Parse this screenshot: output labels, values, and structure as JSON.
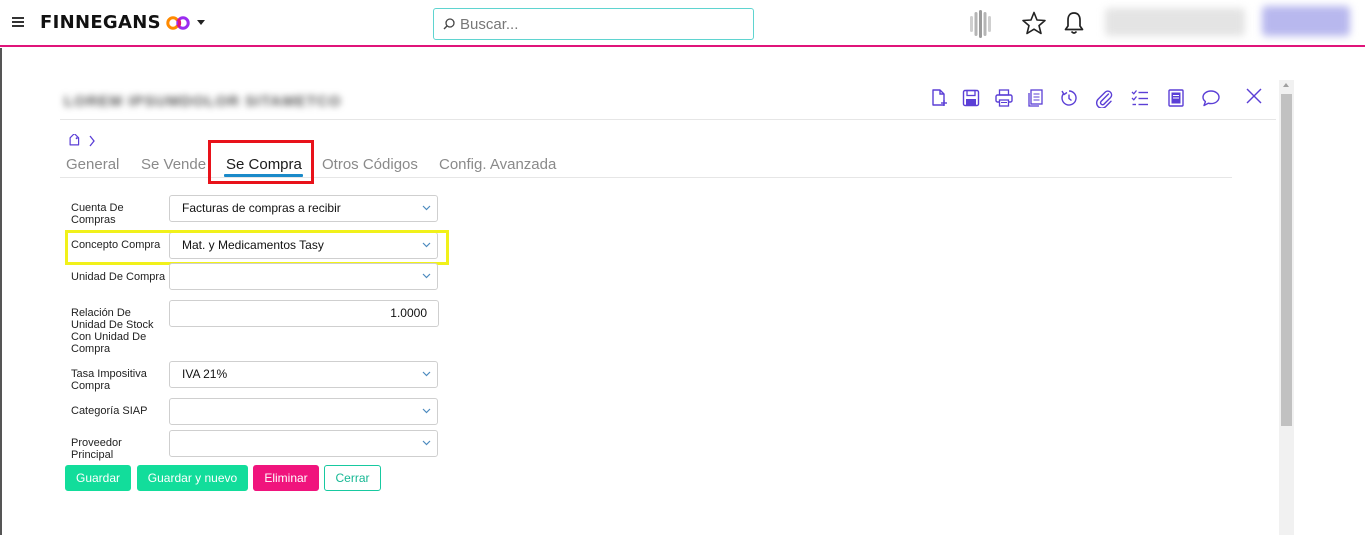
{
  "brand": {
    "name": "FINNEGANS"
  },
  "search": {
    "placeholder": "Buscar..."
  },
  "tabs": [
    {
      "label": "General"
    },
    {
      "label": "Se Vende"
    },
    {
      "label": "Se Compra"
    },
    {
      "label": "Otros Códigos"
    },
    {
      "label": "Config. Avanzada"
    }
  ],
  "form": {
    "cuenta_compras": {
      "label": "Cuenta De Compras",
      "value": "Facturas de compras a recibir"
    },
    "concepto_compra": {
      "label": "Concepto Compra",
      "value": "Mat. y Medicamentos Tasy"
    },
    "unidad_compra": {
      "label": "Unidad De Compra",
      "value": ""
    },
    "relacion_unidad": {
      "label": "Relación De Unidad De Stock Con Unidad De Compra",
      "value": "1.0000"
    },
    "tasa_impositiva": {
      "label": "Tasa Impositiva Compra",
      "value": "IVA 21%"
    },
    "categoria_siap": {
      "label": "Categoría SIAP",
      "value": ""
    },
    "proveedor_principal": {
      "label": "Proveedor Principal",
      "value": ""
    }
  },
  "buttons": {
    "guardar": "Guardar",
    "guardar_nuevo": "Guardar y nuevo",
    "eliminar": "Eliminar",
    "cerrar": "Cerrar"
  },
  "colors": {
    "accent_pink": "#e0147a",
    "search_border": "#5fd4d0",
    "tab_underline": "#1a8ac9",
    "toolbar_icon": "#5b3fd6",
    "button_green": "#12dd9b",
    "button_pink": "#f0147d",
    "highlight_red": "#e8121a",
    "highlight_yellow": "#f1f11a"
  },
  "icons": {
    "topbar": [
      "menu-icon",
      "brand-logo-icon",
      "chevron-down-icon",
      "search-icon",
      "app-logo-icon",
      "star-icon",
      "bell-icon"
    ],
    "toolbar": [
      "new-document-icon",
      "save-icon",
      "print-icon",
      "copy-icon",
      "history-icon",
      "attachment-icon",
      "checklist-icon",
      "report-icon",
      "comment-icon",
      "close-icon"
    ]
  }
}
